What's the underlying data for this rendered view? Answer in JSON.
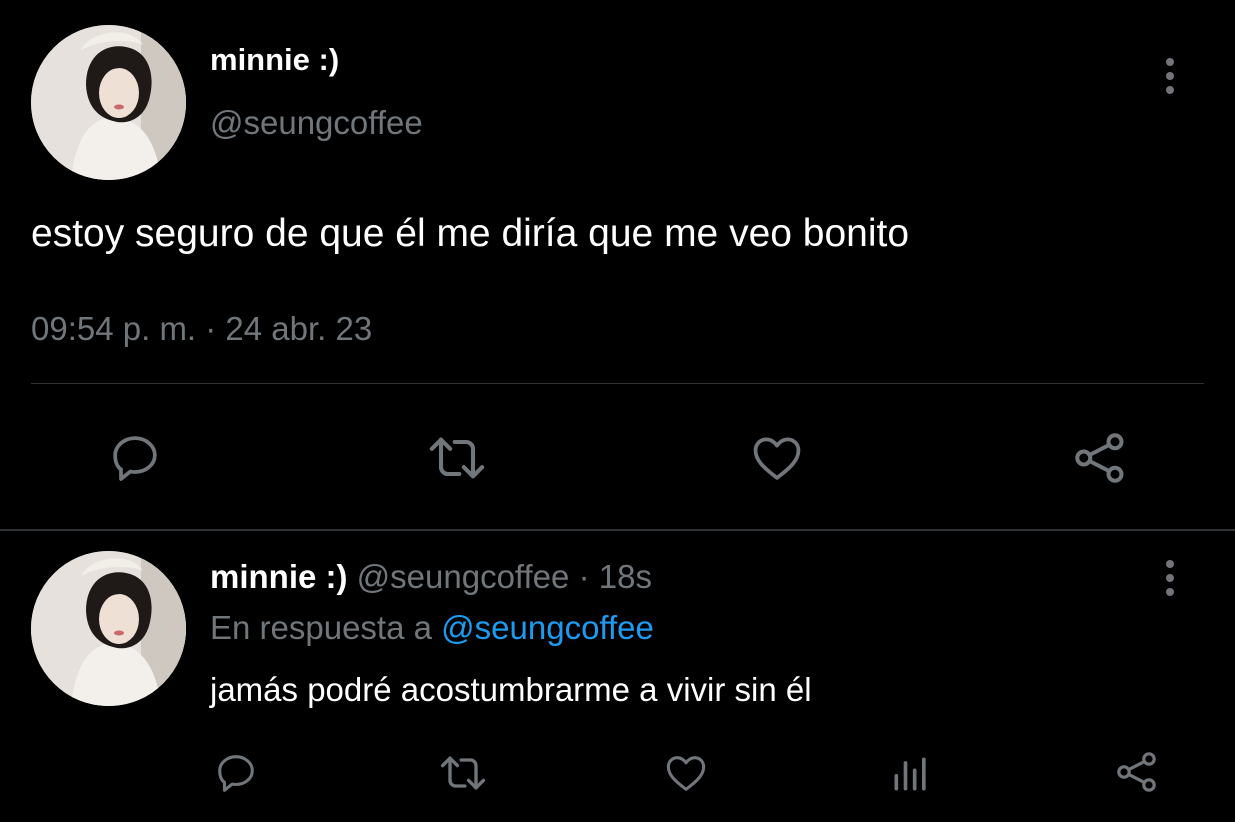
{
  "main_tweet": {
    "display_name": "minnie :)",
    "handle": "@seungcoffee",
    "text": "estoy seguro de que él me diría que me veo bonito",
    "timestamp": "09:54 p. m. · 24 abr. 23",
    "actions": [
      "reply-icon",
      "retweet-icon",
      "like-icon",
      "share-icon"
    ]
  },
  "reply_tweet": {
    "display_name": "minnie :)",
    "handle": "@seungcoffee",
    "separator": "·",
    "age": "18s",
    "replying_prefix": "En respuesta a",
    "replying_to": "@seungcoffee",
    "text": "jamás podré acostumbrarme a vivir sin él",
    "actions": [
      "reply-icon",
      "retweet-icon",
      "like-icon",
      "analytics-icon",
      "share-icon"
    ]
  },
  "colors": {
    "background": "#000000",
    "text": "#ffffff",
    "muted": "#71767b",
    "link": "#1d9bf0",
    "divider": "#2f3336"
  }
}
